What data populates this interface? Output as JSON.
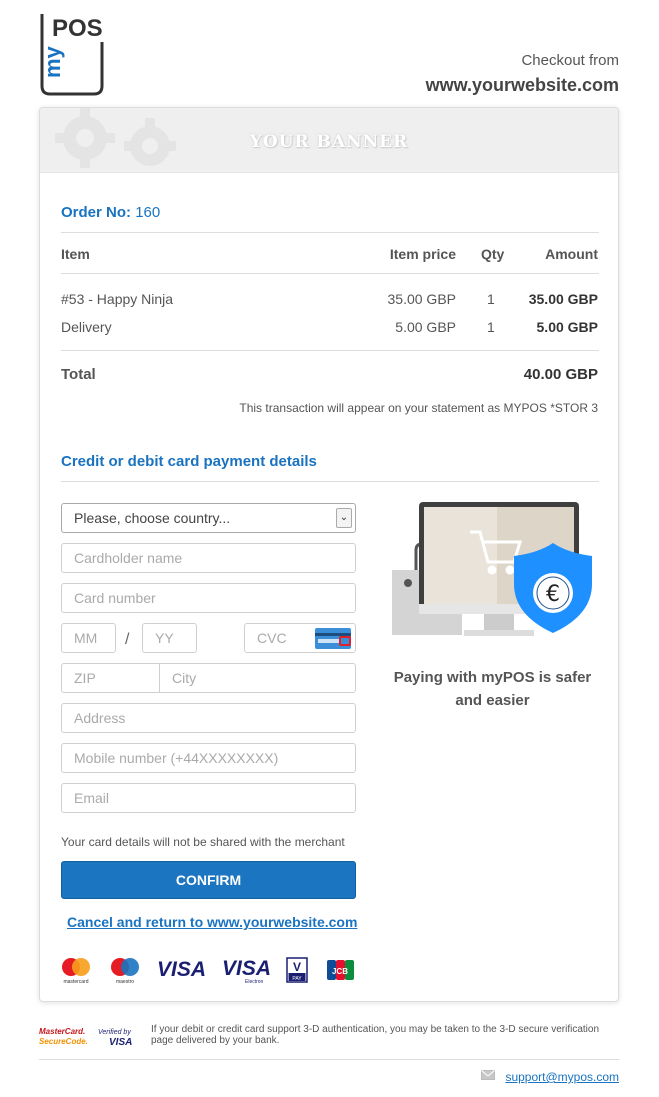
{
  "header": {
    "logo_pos": "POS",
    "logo_my": "my",
    "checkout_from": "Checkout from",
    "website": "www.yourwebsite.com"
  },
  "banner": {
    "text": "YOUR BANNER"
  },
  "order": {
    "label": "Order No:",
    "number": "160"
  },
  "table": {
    "headers": {
      "item": "Item",
      "item_price": "Item price",
      "qty": "Qty",
      "amount": "Amount"
    },
    "rows": [
      {
        "item": "#53 - Happy Ninja",
        "item_price": "35.00 GBP",
        "qty": "1",
        "amount": "35.00 GBP"
      },
      {
        "item": "Delivery",
        "item_price": "5.00 GBP",
        "qty": "1",
        "amount": "5.00 GBP"
      }
    ],
    "total_label": "Total",
    "total_value": "40.00 GBP",
    "statement": "This transaction will appear on your statement as MYPOS  *STOR 3"
  },
  "payment": {
    "title": "Credit or debit card payment details",
    "country_value": "Please, choose country...",
    "cardholder_placeholder": "Cardholder name",
    "card_number_placeholder": "Card number",
    "mm_placeholder": "MM",
    "slash": "/",
    "yy_placeholder": "YY",
    "cvc_placeholder": "CVC",
    "zip_placeholder": "ZIP",
    "city_placeholder": "City",
    "address_placeholder": "Address",
    "mobile_placeholder": "Mobile number (+44XXXXXXXX)",
    "email_placeholder": "Email",
    "disclaimer": "Your card details will not be shared with the merchant",
    "confirm_label": "CONFIRM",
    "cancel_label": "Cancel and return to www.yourwebsite.com",
    "brands": [
      "mastercard",
      "maestro",
      "VISA",
      "VISA Electron",
      "V PAY",
      "JCB"
    ],
    "mastercard_label": "mastercard",
    "maestro_label": "maestro",
    "visa_label": "VISA",
    "visa_electron_label": "VISA",
    "visa_electron_sub": "Electron",
    "vpay_label": "V",
    "vpay_sub": "PAY",
    "jcb_label": "JCB"
  },
  "promo": {
    "text": "Paying with myPOS is safer and easier",
    "currency_symbol": "€"
  },
  "footer": {
    "securecode_line1": "MasterCard.",
    "securecode_line2": "SecureCode.",
    "verified_line1": "Verified by",
    "verified_line2": "VISA",
    "notice": "If your debit or credit card support 3-D authentication, you may be taken to the 3-D secure verification page delivered by your bank.",
    "support_email": "support@mypos.com"
  },
  "colors": {
    "accent": "#1a73c0",
    "button": "#1b75c0",
    "shield": "#1e90ff"
  }
}
